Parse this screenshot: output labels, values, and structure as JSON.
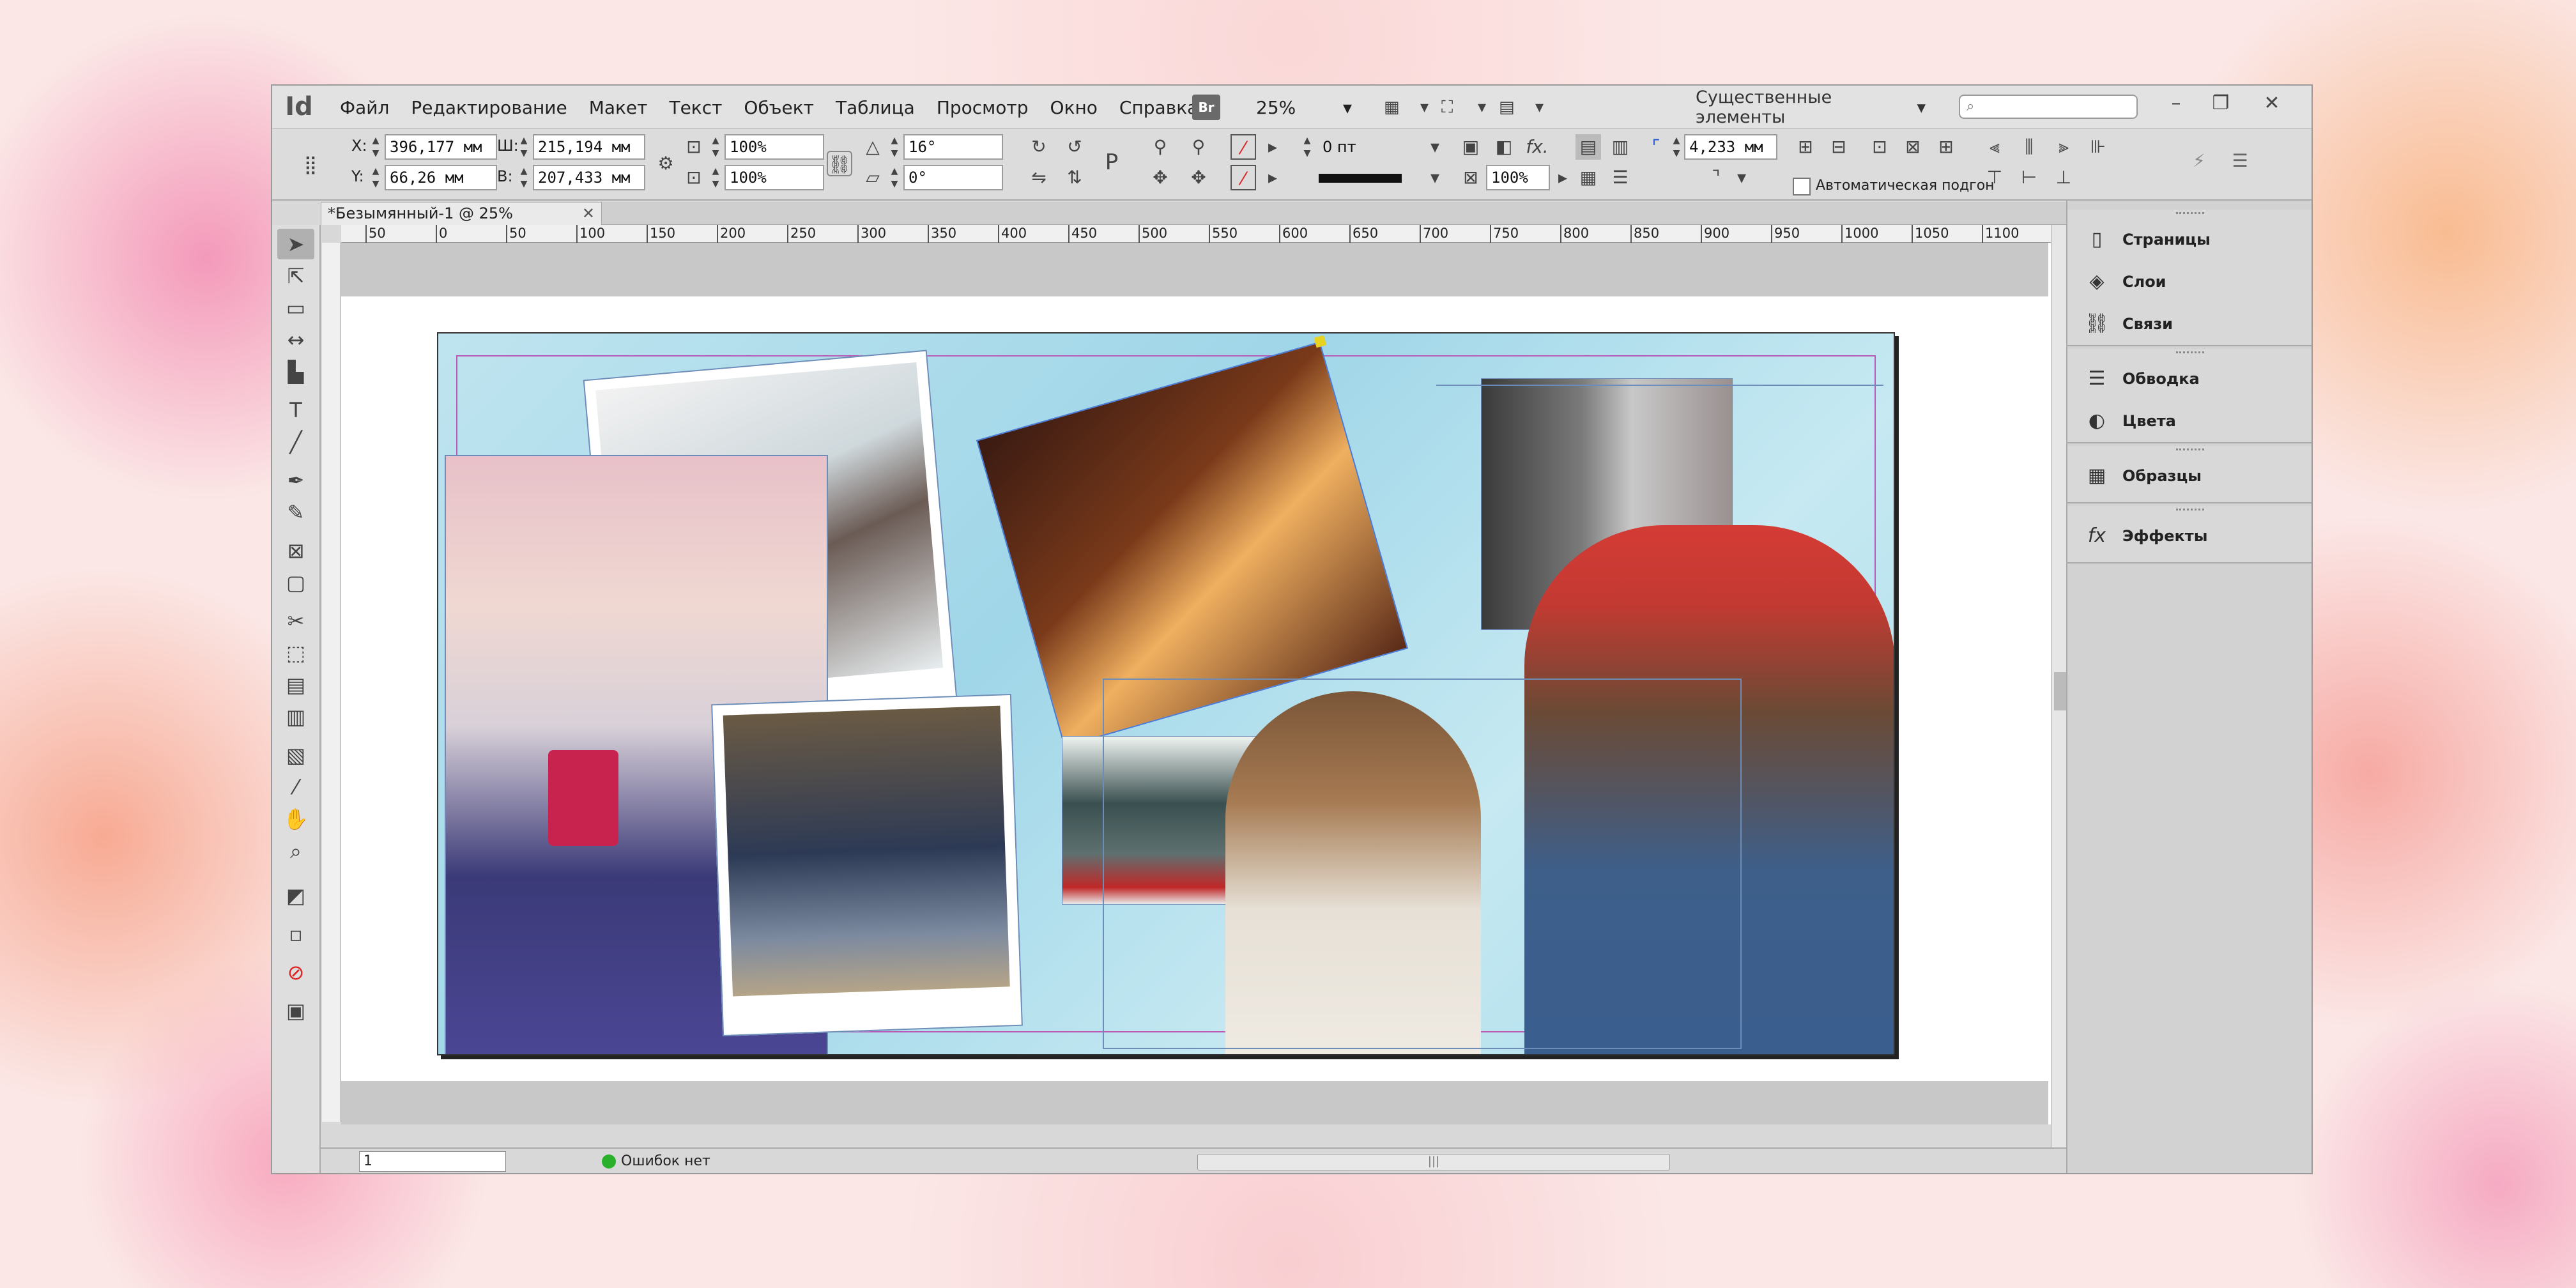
{
  "app": {
    "logo": "Id"
  },
  "menu": [
    "Файл",
    "Редактирование",
    "Макет",
    "Текст",
    "Объект",
    "Таблица",
    "Просмотр",
    "Окно",
    "Справка"
  ],
  "bridge": "Br",
  "zoom": "25%",
  "workspace": "Существенные элементы",
  "control": {
    "x_label": "X:",
    "x_value": "396,177 мм",
    "y_label": "Y:",
    "y_value": "66,26 мм",
    "w_label": "Ш:",
    "w_value": "215,194 мм",
    "h_label": "В:",
    "h_value": "207,433 мм",
    "scale_x": "100%",
    "scale_y": "100%",
    "rotate": "16°",
    "shear": "0°",
    "stroke_weight": "0 пт",
    "opacity": "100%",
    "gap": "4,233 мм",
    "auto_fit": "Автоматическая подгон"
  },
  "doc_tab": "*Безымянный-1 @ 25%",
  "ruler": [
    "50",
    "0",
    "50",
    "100",
    "150",
    "200",
    "250",
    "300",
    "350",
    "400",
    "450",
    "500",
    "550",
    "600",
    "650",
    "700",
    "750",
    "800",
    "850",
    "900",
    "950",
    "1000",
    "1050",
    "1100"
  ],
  "status": {
    "page": "1",
    "errors": "Ошибок нет"
  },
  "panels": [
    {
      "items": [
        {
          "icon": "pages-icon",
          "label": "Страницы"
        },
        {
          "icon": "layers-icon",
          "label": "Слои"
        },
        {
          "icon": "links-icon",
          "label": "Связи"
        }
      ]
    },
    {
      "items": [
        {
          "icon": "stroke-icon",
          "label": "Обводка"
        },
        {
          "icon": "color-icon",
          "label": "Цвета"
        }
      ]
    },
    {
      "items": [
        {
          "icon": "swatches-icon",
          "label": "Образцы"
        }
      ]
    },
    {
      "items": [
        {
          "icon": "effects-icon",
          "label": "Эффекты"
        }
      ]
    }
  ]
}
